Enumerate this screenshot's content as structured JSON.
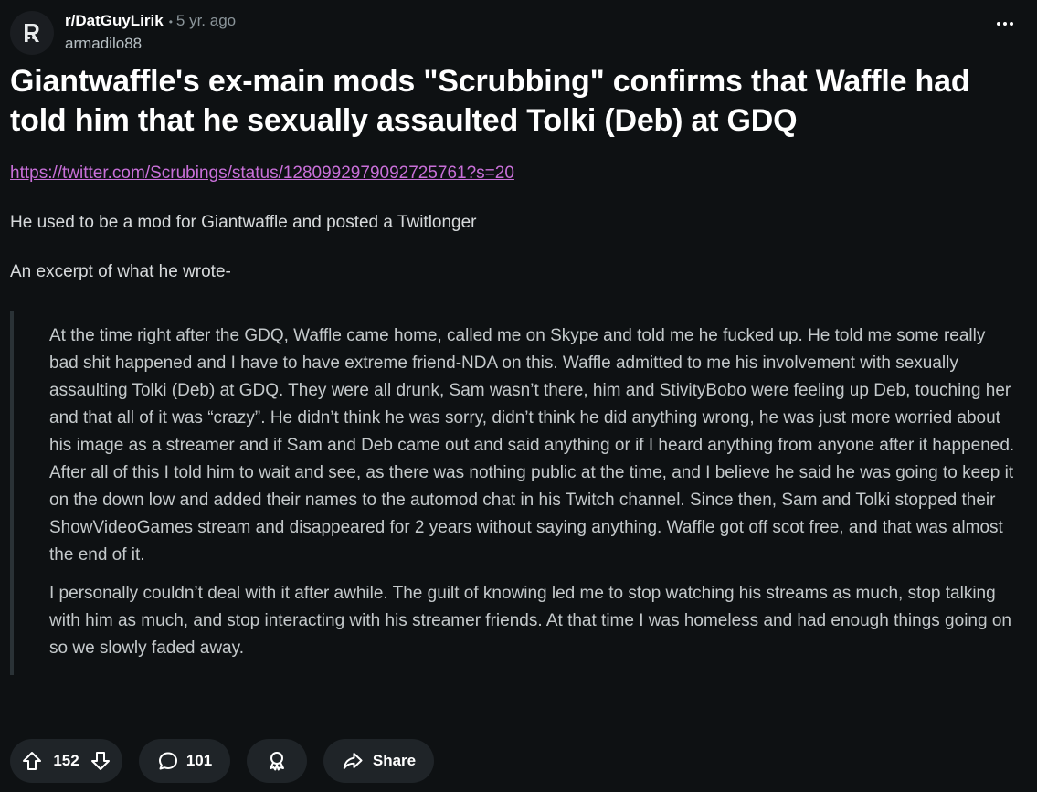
{
  "post": {
    "subreddit": "r/DatGuyLirik",
    "separator": "•",
    "age": "5 yr. ago",
    "author": "armadilo88",
    "title": "Giantwaffle's ex-main mods \"Scrubbing\" confirms that Waffle had told him that he sexually assaulted Tolki (Deb) at GDQ",
    "link": "https://twitter.com/Scrubings/status/1280992979092725761?s=20",
    "paragraphs": [
      "He used to be a mod for Giantwaffle and posted a Twitlonger",
      "An excerpt of what he wrote-"
    ],
    "quote": [
      "At the time right after the GDQ, Waffle came home, called me on Skype and told me he fucked up. He told me some really bad shit happened and I have to have extreme friend-NDA on this. Waffle admitted to me his involvement with sexually assaulting Tolki (Deb) at GDQ. They were all drunk, Sam wasn’t there, him and StivityBobo were feeling up Deb, touching her and that all of it was “crazy”. He didn’t think he was sorry, didn’t think he did anything wrong, he was just more worried about his image as a streamer and if Sam and Deb came out and said anything or if I heard anything from anyone after it happened. After all of this I told him to wait and see, as there was nothing public at the time, and I believe he said he was going to keep it on the down low and added their names to the automod chat in his Twitch channel. Since then, Sam and Tolki stopped their ShowVideoGames stream and disappeared for 2 years without saying anything. Waffle got off scot free, and that was almost the end of it.",
      "I personally couldn’t deal with it after awhile. The guilt of knowing led me to stop watching his streams as much, stop talking with him as much, and stop interacting with his streamer friends. At that time I was homeless and had enough things going on so we slowly faded away."
    ]
  },
  "actions": {
    "votes": "152",
    "comments": "101",
    "share_label": "Share"
  },
  "icons": {
    "subreddit_avatar": "reddit-logo-icon",
    "more": "more-options-icon",
    "upvote": "upvote-arrow-icon",
    "downvote": "downvote-arrow-icon",
    "comment": "comment-bubble-icon",
    "award": "award-icon",
    "share": "share-arrow-icon"
  },
  "colors": {
    "background": "#0e1113",
    "link": "#c970d9",
    "pill": "#1f2428",
    "quote_bar": "#2a3236"
  }
}
